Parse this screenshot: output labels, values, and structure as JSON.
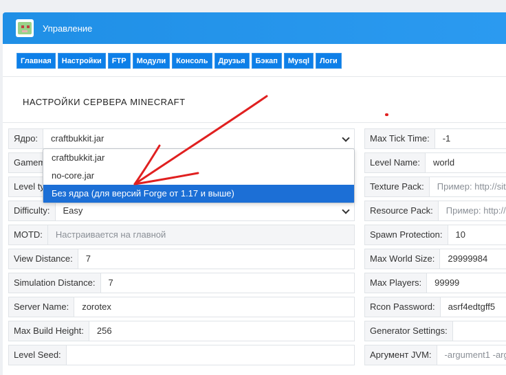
{
  "app": {
    "title": "Управление"
  },
  "nav": {
    "tabs": [
      "Главная",
      "Настройки",
      "FTP",
      "Модули",
      "Консоль",
      "Друзья",
      "Бэкап",
      "Mysql",
      "Логи"
    ]
  },
  "page": {
    "heading": "НАСТРОЙКИ СЕРВЕРА MINECRAFT"
  },
  "left_fields": {
    "core": {
      "label": "Ядро:",
      "value": "craftbukkit.jar"
    },
    "gamemode": {
      "label": "Gamem"
    },
    "level_type": {
      "label": "Level ty"
    },
    "difficulty": {
      "label": "Difficulty:",
      "value": "Easy"
    },
    "motd": {
      "label": "MOTD:",
      "value": "Настраивается на главной"
    },
    "view_distance": {
      "label": "View Distance:",
      "value": "7"
    },
    "simulation_distance": {
      "label": "Simulation Distance:",
      "value": "7"
    },
    "server_name": {
      "label": "Server Name:",
      "value": "zorotex"
    },
    "max_build_height": {
      "label": "Max Build Height:",
      "value": "256"
    },
    "level_seed": {
      "label": "Level Seed:",
      "value": ""
    }
  },
  "right_fields": {
    "max_tick_time": {
      "label": "Max Tick Time:",
      "value": "-1"
    },
    "level_name": {
      "label": "Level Name:",
      "value": "world"
    },
    "texture_pack": {
      "label": "Texture Pack:",
      "placeholder": "Пример: http://site"
    },
    "resource_pack": {
      "label": "Resource Pack:",
      "placeholder": "Пример: http://"
    },
    "spawn_protection": {
      "label": "Spawn Protection:",
      "value": "10"
    },
    "max_world_size": {
      "label": "Max World Size:",
      "value": "29999984"
    },
    "max_players": {
      "label": "Max Players:",
      "value": "99999"
    },
    "rcon_password": {
      "label": "Rcon Password:",
      "value": "asrf4edtgff5"
    },
    "generator_settings": {
      "label": "Generator Settings:",
      "value": ""
    },
    "jvm_args": {
      "label": "Аргумент JVM:",
      "placeholder": "-argument1 -arg"
    }
  },
  "core_dropdown": {
    "options": [
      "craftbukkit.jar",
      "no-core.jar",
      "Без ядра (для версий Forge от 1.17 и выше)"
    ],
    "highlighted_index": 2
  },
  "colors": {
    "header": "#2196f3",
    "tab": "#0d7fe8",
    "highlight": "#1c6fd6",
    "annotation": "#e02020"
  }
}
